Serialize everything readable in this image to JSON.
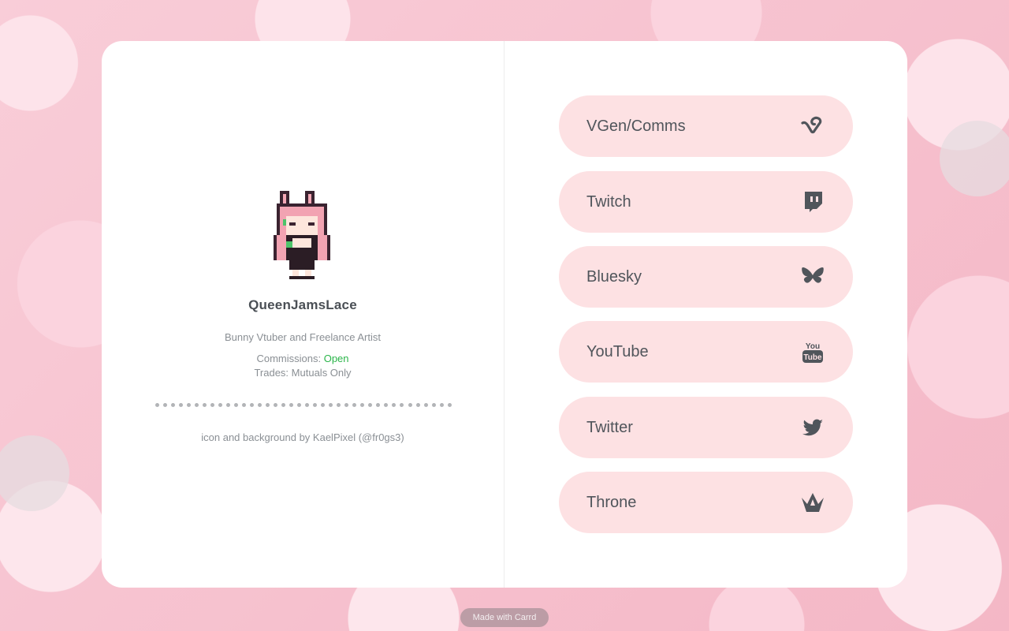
{
  "profile": {
    "name": "QueenJamsLace",
    "tagline": "Bunny Vtuber and Freelance Artist",
    "commissions_label": "Commissions:",
    "commissions_status": "Open",
    "trades_label": "Trades:",
    "trades_status": "Mutuals Only",
    "credit": "icon and background by KaelPixel (@fr0gs3)"
  },
  "links": [
    {
      "label": "VGen/Comms",
      "icon": "vgen-icon"
    },
    {
      "label": "Twitch",
      "icon": "twitch-icon"
    },
    {
      "label": "Bluesky",
      "icon": "bluesky-butterfly-icon"
    },
    {
      "label": "YouTube",
      "icon": "youtube-icon"
    },
    {
      "label": "Twitter",
      "icon": "twitter-bird-icon"
    },
    {
      "label": "Throne",
      "icon": "throne-crown-icon"
    }
  ],
  "footer": {
    "made_with": "Made with Carrd"
  },
  "colors": {
    "button_bg": "#fde1e3",
    "text": "#50555b",
    "open_status": "#2bb54a",
    "icon": "#50555b"
  }
}
